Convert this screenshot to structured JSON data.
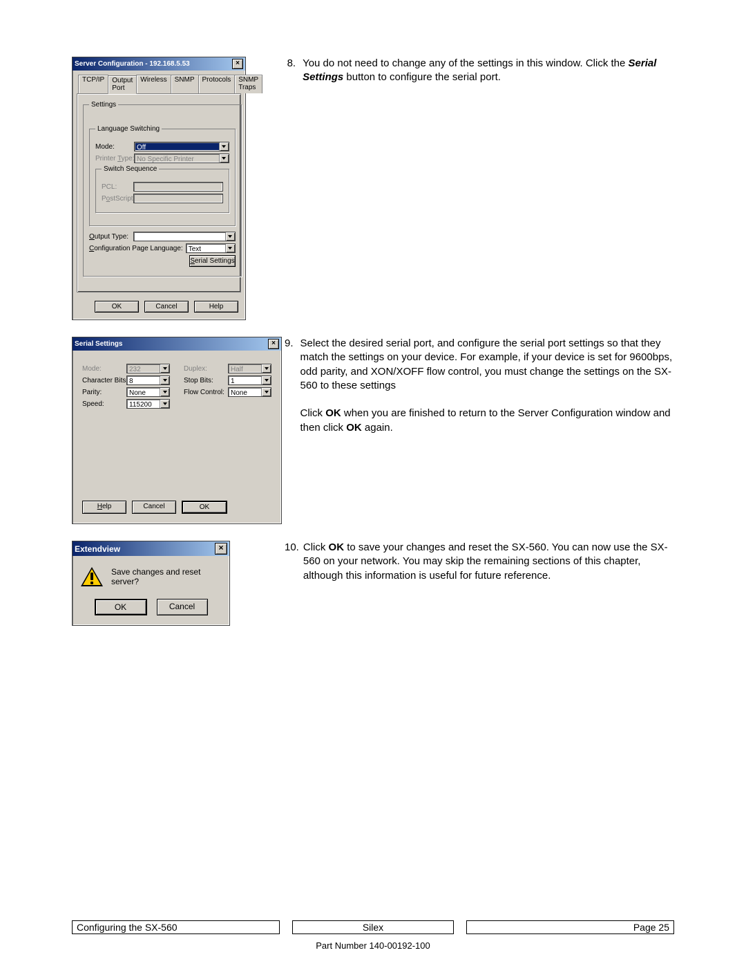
{
  "steps": {
    "s8": {
      "num": "8.",
      "text_a": "You do not need to change any of the settings in this window.  Click the ",
      "serial_settings": "Serial Settings",
      "text_b": " button to configure the serial port."
    },
    "s9": {
      "num": "9.",
      "text": "Select the desired serial port, and configure the serial port settings so that they match the settings on your device.  For example, if your device is set for 9600bps, odd parity, and XON/XOFF flow control, you must change the settings on the SX-560 to these settings",
      "para2_a": "Click ",
      "ok": "OK",
      "para2_b": " when you are finished to return to the Server Configuration window and then click ",
      "para2_c": " again."
    },
    "s10": {
      "num": "10.",
      "text_a": "Click ",
      "ok": "OK",
      "text_b": " to save your changes and reset the SX-560.  You can now use the SX-560 on your network.  You may skip the remaining sections of this chapter, although this information is useful for future reference."
    }
  },
  "win1": {
    "title": "Server Configuration - 192.168.5.53",
    "tabs": [
      "TCP/IP",
      "Output Port",
      "Wireless",
      "SNMP",
      "Protocols",
      "SNMP Traps"
    ],
    "settings_legend": "Settings",
    "lang_legend": "Language Switching",
    "mode_label": "Mode:",
    "mode_value": "Off",
    "printer_type_label_pre": "Printer ",
    "printer_type_label_u": "T",
    "printer_type_label_post": "ype:",
    "printer_type_value": "No Specific Printer",
    "switch_legend": "Switch Sequence",
    "pcl_label": "PCL:",
    "ps_label_pre": "P",
    "ps_label_u": "o",
    "ps_label_post": "stScript:",
    "output_type_label_u": "O",
    "output_type_label_post": "utput Type:",
    "cfg_lang_label_u": "C",
    "cfg_lang_label_post": "onfiguration Page Language:",
    "cfg_lang_value": "Text",
    "serial_btn_u": "S",
    "serial_btn_post": "erial Settings",
    "ok": "OK",
    "cancel": "Cancel",
    "help": "Help"
  },
  "win2": {
    "title": "Serial Settings",
    "mode_label": "Mode:",
    "mode_value": "232",
    "charbits_label": "Character Bits:",
    "charbits_value": "8",
    "parity_label": "Parity:",
    "parity_value": "None",
    "speed_label": "Speed:",
    "speed_value": "115200",
    "duplex_label": "Duplex:",
    "duplex_value": "Half",
    "stopbits_label": "Stop Bits:",
    "stopbits_value": "1",
    "flow_label": "Flow Control:",
    "flow_value": "None",
    "help_u": "H",
    "help_post": "elp",
    "cancel": "Cancel",
    "ok": "OK"
  },
  "modal": {
    "title": "Extendview",
    "message": "Save changes and reset server?",
    "ok": "OK",
    "cancel": "Cancel"
  },
  "footer": {
    "left": "Configuring the SX-560",
    "center": "Silex",
    "right": "Page 25",
    "part": "Part Number 140-00192-100"
  }
}
